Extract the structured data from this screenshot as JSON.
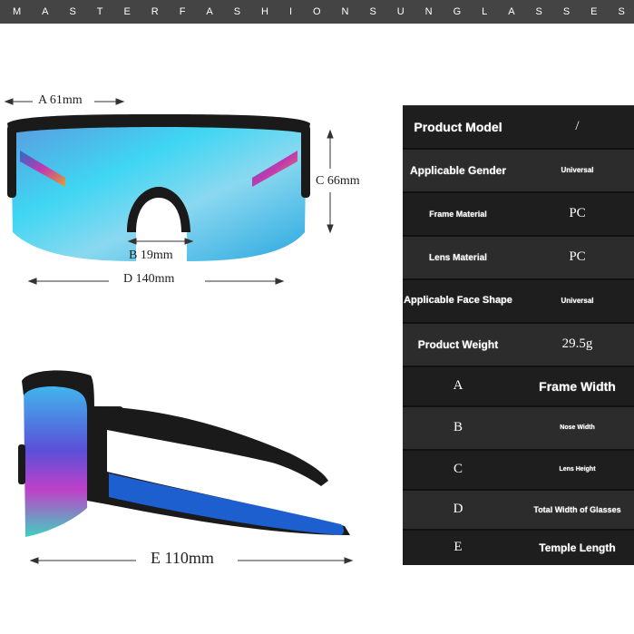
{
  "banner": {
    "text": "MASTERFASHIONSUNGLASSES"
  },
  "dimensions": {
    "a": "A 61mm",
    "b": "B 19mm",
    "c": "C 66mm",
    "d": "D 140mm",
    "e": "E 110mm"
  },
  "specs": [
    {
      "label": "Product Model",
      "value": "/"
    },
    {
      "label": "Applicable Gender",
      "value": "Universal"
    },
    {
      "label": "Frame Material",
      "value": "PC"
    },
    {
      "label": "Lens Material",
      "value": "PC"
    },
    {
      "label": "Applicable Face Shape",
      "value": "Universal"
    },
    {
      "label": "Product Weight",
      "value": "29.5g"
    },
    {
      "label": "A",
      "value": "Frame Width"
    },
    {
      "label": "B",
      "value": "Nose Width"
    },
    {
      "label": "C",
      "value": "Lens Height"
    },
    {
      "label": "D",
      "value": "Total Width of Glasses"
    },
    {
      "label": "E",
      "value": "Temple Length"
    }
  ],
  "colors": {
    "banner": "#444444",
    "table_bg": "#1a1a1a",
    "row_dark": "#1e1e1e",
    "row_light": "#2c2c2c",
    "lens_blue": "#3fd0f0",
    "temple_blue": "#1e5fd0"
  }
}
